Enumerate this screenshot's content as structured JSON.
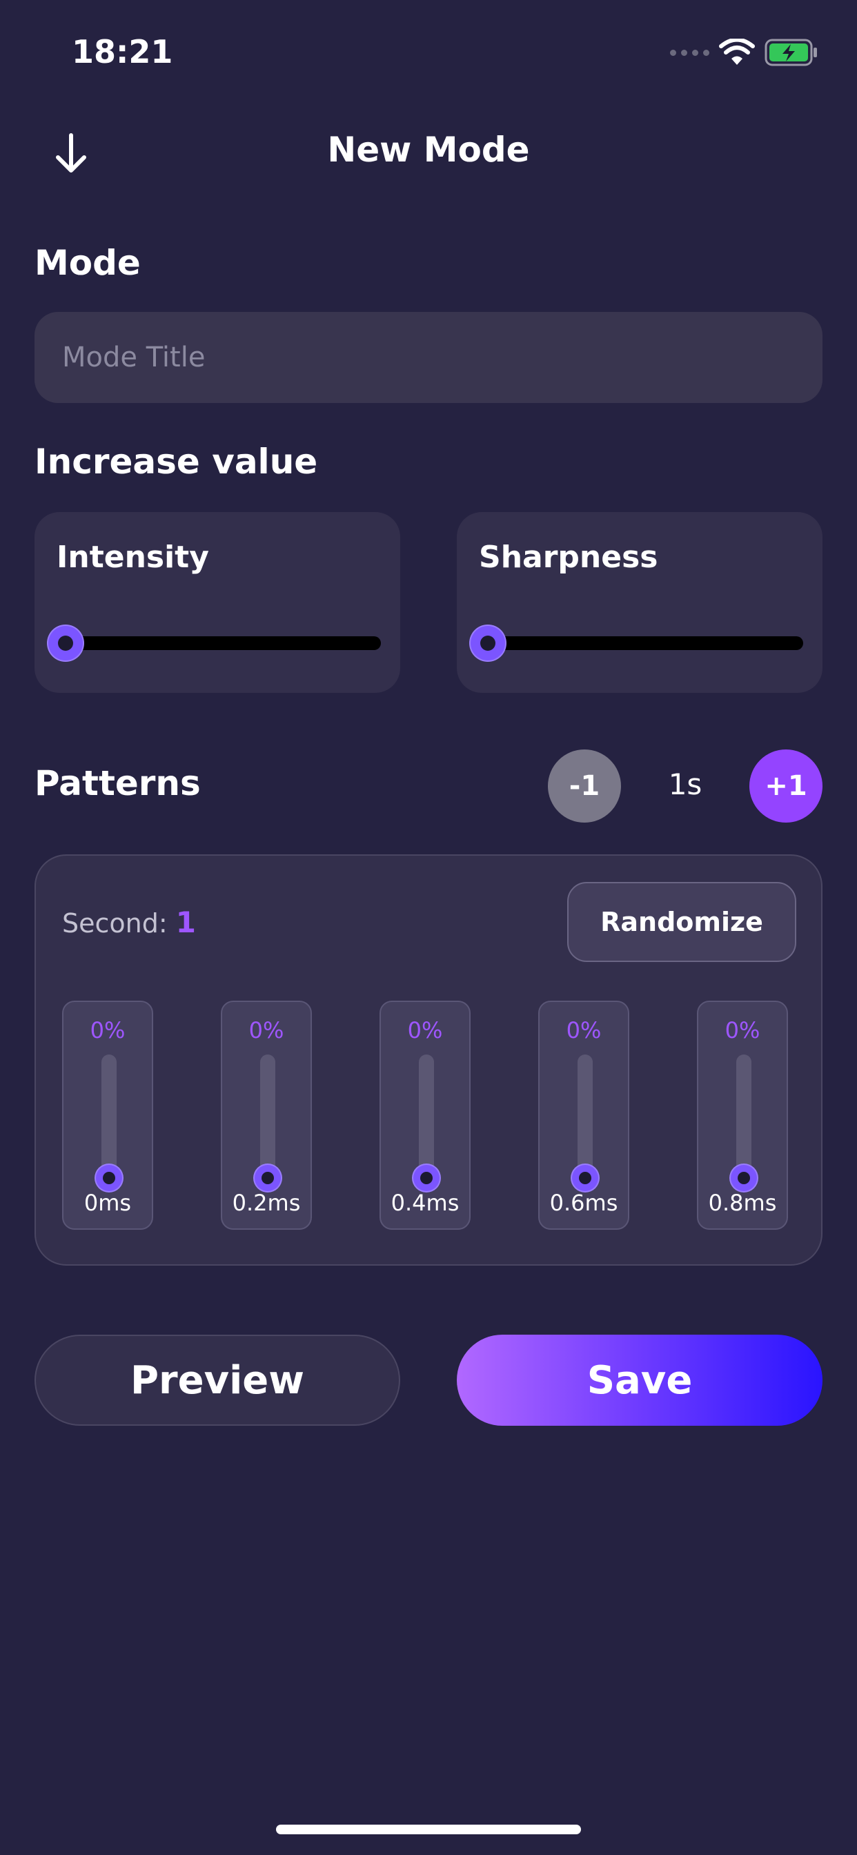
{
  "status_bar": {
    "time": "18:21",
    "battery_color": "#34c759"
  },
  "header": {
    "title": "New Mode",
    "back_icon": "arrow-down-icon"
  },
  "mode": {
    "label": "Mode",
    "placeholder": "Mode Title",
    "value": ""
  },
  "increase": {
    "label": "Increase value",
    "sliders": [
      {
        "label": "Intensity",
        "value": 0
      },
      {
        "label": "Sharpness",
        "value": 0
      }
    ]
  },
  "patterns": {
    "label": "Patterns",
    "minus_label": "-1",
    "duration": "1s",
    "plus_label": "+1",
    "second_label": "Second:",
    "second_value": "1",
    "randomize_label": "Randomize",
    "columns": [
      {
        "percent": "0%",
        "time": "0ms"
      },
      {
        "percent": "0%",
        "time": "0.2ms"
      },
      {
        "percent": "0%",
        "time": "0.4ms"
      },
      {
        "percent": "0%",
        "time": "0.6ms"
      },
      {
        "percent": "0%",
        "time": "0.8ms"
      }
    ]
  },
  "actions": {
    "preview_label": "Preview",
    "save_label": "Save"
  },
  "colors": {
    "background": "#252241",
    "accent": "#9e56ff",
    "save_gradient_end": "#2a14ff"
  }
}
